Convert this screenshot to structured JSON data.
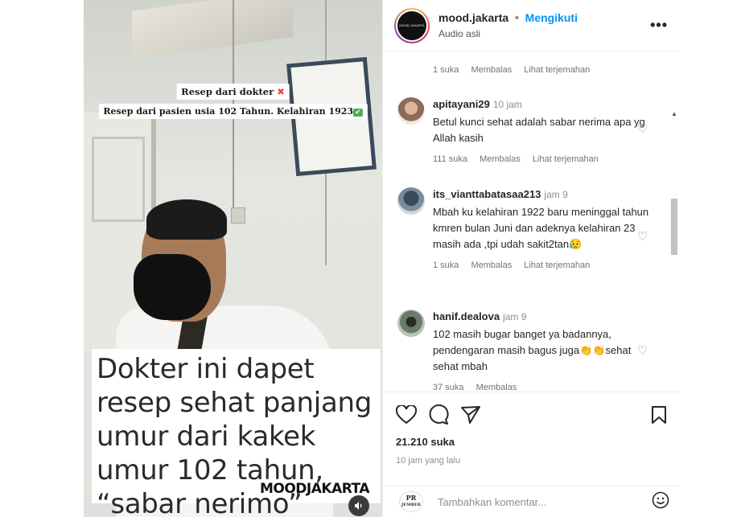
{
  "video": {
    "caption_line1": "Resep dari dokter",
    "caption_line2": "Resep dari pasien usia 102 Tahun. Kelahiran 1923",
    "overlay_text": "Dokter ini dapet resep sehat panjang umur dari kakek umur 102 tahun, “sabar nerimo”",
    "brand": "MOODJAKARTA",
    "audio_icon": "speaker-icon"
  },
  "header": {
    "username": "mood.jakarta",
    "dot": "•",
    "follow_label": "Mengikuti",
    "audio_label": "Audio asli",
    "more_label": "•••",
    "avatar_text": "MOOD JAKARTA"
  },
  "comments": [
    {
      "meta": {
        "likes": "1 suka",
        "reply": "Membalas",
        "translate": "Lihat terjemahan"
      }
    },
    {
      "username": "apitayani29",
      "time": "10 jam",
      "text": "Betul kunci sehat adalah sabar nerima apa yg Allah kasih",
      "meta": {
        "likes": "111 suka",
        "reply": "Membalas",
        "translate": "Lihat terjemahan"
      }
    },
    {
      "username": "its_vianttabatasaa213",
      "time": "jam 9",
      "text": "Mbah ku kelahiran 1922 baru meninggal tahun kmren bulan Juni dan adeknya kelahiran 23 masih ada ,tpi udah sakit2tan😥",
      "meta": {
        "likes": "1 suka",
        "reply": "Membalas",
        "translate": "Lihat terjemahan"
      }
    },
    {
      "username": "hanif.dealova",
      "time": "jam 9",
      "text": "102 masih bugar banget ya badannya, pendengaran masih bagus juga👏👏sehat sehat mbah",
      "meta": {
        "likes": "37 suka",
        "reply": "Membalas",
        "translate": ""
      }
    }
  ],
  "actions": {
    "likes": "21.210 suka",
    "time_ago": "10 jam yang lalu"
  },
  "add_comment": {
    "placeholder": "Tambahkan komentar...",
    "logo_text": "PR",
    "logo_sub": "JEMBER"
  },
  "colors": {
    "accent": "#0095f6",
    "text": "#262626",
    "muted": "#8e8e8e"
  }
}
